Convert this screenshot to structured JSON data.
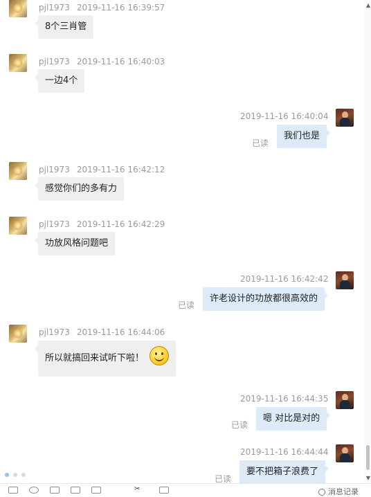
{
  "peer_name": "pjl1973",
  "read_label": "已读",
  "messages": [
    {
      "sender": "peer",
      "name": "pjl1973",
      "time": "2019-11-16 16:39:57",
      "text": "8个三肖管"
    },
    {
      "sender": "peer",
      "name": "pjl1973",
      "time": "2019-11-16 16:40:03",
      "text": "一边4个"
    },
    {
      "sender": "self",
      "time": "2019-11-16 16:40:04",
      "text": "我们也是",
      "status": "已读"
    },
    {
      "sender": "peer",
      "name": "pjl1973",
      "time": "2019-11-16 16:42:12",
      "text": "感觉你们的多有力"
    },
    {
      "sender": "peer",
      "name": "pjl1973",
      "time": "2019-11-16 16:42:29",
      "text": "功放风格问题吧"
    },
    {
      "sender": "self",
      "time": "2019-11-16 16:42:42",
      "text": "许老设计的功放都很高效的",
      "status": "已读"
    },
    {
      "sender": "peer",
      "name": "pjl1973",
      "time": "2019-11-16 16:44:06",
      "text": "所以就搞回来试听下啦！",
      "emoji": "smile-emoji-icon"
    },
    {
      "sender": "self",
      "time": "2019-11-16 16:44:35",
      "text": "嗯 对比是对的",
      "status": "已读"
    },
    {
      "sender": "self",
      "time": "2019-11-16 16:44:44",
      "text": "要不把箱子浪费了",
      "status": "已读"
    }
  ],
  "toolbar": {
    "history_label": "消息记录",
    "icons": [
      "font-icon",
      "emoji-icon",
      "screenshot-icon",
      "folder-icon",
      "image-icon",
      "scissors-icon",
      "more-icon"
    ]
  },
  "colors": {
    "peer_bubble": "#efefef",
    "self_bubble": "#ddebf9",
    "meta_text": "#9a9a9a"
  }
}
